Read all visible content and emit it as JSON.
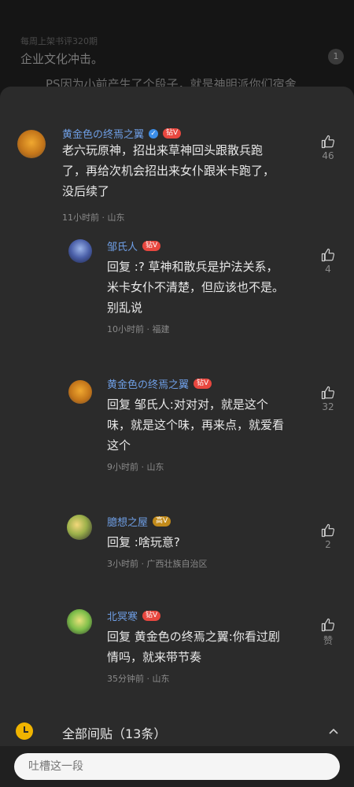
{
  "background": {
    "top_text": "每周上架书评320期",
    "title": "企业文化冲击。",
    "badge": "1",
    "body": "PS因为小前产生了个段子，就是神明派你们宿舍"
  },
  "comments": [
    {
      "name": "黄金色の终焉之翼",
      "badge": "钻V",
      "body_lines": [
        "老六玩原神，招出来草神回头跟散兵跑",
        "了，再给次机会招出来女仆跟米卡跑了，",
        "没后续了"
      ],
      "meta": "11小时前 · 山东",
      "likes": "46"
    },
    {
      "name": "邹氏人",
      "badge": "钻V",
      "body_lines": [
        "回复 :? 草神和散兵是护法关系，",
        "米卡女仆不清楚，但应该也不是。",
        "别乱说"
      ],
      "meta": "10小时前 · 福建",
      "likes": "4"
    },
    {
      "name": "黄金色の终焉之翼",
      "badge": "钻V",
      "body_lines": [
        "回复 邹氏人:对对对，就是这个",
        "味，就是这个味，再来点，就爱看",
        "这个"
      ],
      "meta": "9小时前 · 山东",
      "likes": "32"
    },
    {
      "name": "臆想之屋",
      "badge": "高V",
      "body_lines": [
        "回复 :啥玩意?"
      ],
      "meta": "3小时前 · 广西壮族自治区",
      "likes": "2"
    },
    {
      "name": "北冥寒",
      "badge": "钻V",
      "body_lines": [
        "回复 黄金色の终焉之翼:你看过剧",
        "情吗，就来带节奏"
      ],
      "meta": "35分钟前 · 山东",
      "likes": "赞"
    }
  ],
  "footer": {
    "all_label": "全部间贴（13条）"
  },
  "input": {
    "placeholder": "吐槽这一段"
  }
}
